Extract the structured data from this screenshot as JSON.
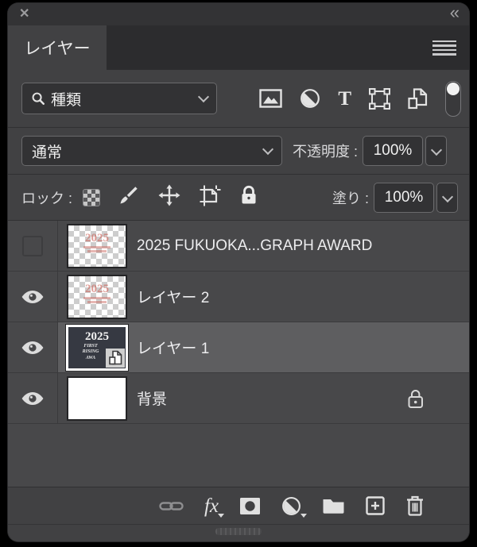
{
  "panel": {
    "tab_label": "レイヤー",
    "glyphs": {
      "close": "✕",
      "collapse": "«"
    }
  },
  "filter": {
    "kind_label": "種類",
    "type_glyph": "T",
    "icons": [
      "pixel-layer-filter",
      "adjustment-layer-filter",
      "type-layer-filter",
      "shape-layer-filter",
      "smart-object-filter",
      "filtering-toggle"
    ]
  },
  "blend": {
    "mode": "通常",
    "opacity_label": "不透明度 :",
    "opacity_value": "100%"
  },
  "lock": {
    "label": "ロック :",
    "icons": [
      "lock-transparent-pixels",
      "lock-image-pixels",
      "lock-position",
      "lock-artboard-nesting",
      "lock-all"
    ],
    "fill_label": "塗り :",
    "fill_value": "100%"
  },
  "layers": [
    {
      "name": "2025 FUKUOKA...GRAPH AWARD",
      "visible": false,
      "selected": false,
      "locked": false,
      "thumb": "transparent-artwork"
    },
    {
      "name": "レイヤー 2",
      "visible": true,
      "selected": false,
      "locked": false,
      "thumb": "transparent-artwork"
    },
    {
      "name": "レイヤー 1",
      "visible": true,
      "selected": true,
      "locked": false,
      "thumb": "dark-smart-object"
    },
    {
      "name": "背景",
      "visible": true,
      "selected": false,
      "locked": true,
      "thumb": "white"
    }
  ],
  "thumb_art": {
    "big_text": "2025",
    "sub_lines": [
      "FIRST",
      "RISING",
      "AWA"
    ]
  },
  "toolbar": {
    "fx_label": "fx",
    "icons": [
      "link-layers",
      "layer-style-fx",
      "add-layer-mask",
      "new-adjustment-layer",
      "new-group",
      "new-layer",
      "delete-layer"
    ]
  },
  "colors": {
    "panel_bg": "#414143",
    "list_bg": "#48484a",
    "selected_row": "#5e5e60",
    "control_bg": "#323234",
    "control_border": "#6a6a6c",
    "text": "#ededef",
    "artwork_accent": "#ca6056"
  }
}
